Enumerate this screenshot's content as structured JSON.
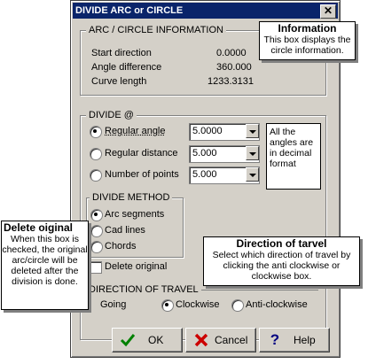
{
  "window": {
    "title": "DIVIDE ARC or CIRCLE",
    "close_glyph": "✕"
  },
  "arc_info": {
    "legend": "ARC / CIRCLE INFORMATION",
    "rows": [
      {
        "label": "Start direction",
        "value": "0.0000"
      },
      {
        "label": "Angle difference",
        "value": "360.000"
      },
      {
        "label": "Curve length",
        "value": "1233.3131"
      }
    ]
  },
  "divide": {
    "legend": "DIVIDE @",
    "options": [
      {
        "label": "Regular angle",
        "value": "5.0000",
        "selected": true
      },
      {
        "label": "Regular distance",
        "value": "5.000",
        "selected": false
      },
      {
        "label": "Number of points",
        "value": "5.000",
        "selected": false
      }
    ],
    "note": "All the angles are in decimal format"
  },
  "divide_method": {
    "legend": "DIVIDE METHOD",
    "options": [
      {
        "label": "Arc segments",
        "selected": true
      },
      {
        "label": "Cad lines",
        "selected": false
      },
      {
        "label": "Chords",
        "selected": false
      }
    ]
  },
  "delete_original": {
    "label": "Delete original",
    "checked": false
  },
  "direction": {
    "legend": "DIRECTION OF TRAVEL",
    "going_label": "Going",
    "options": [
      {
        "label": "Clockwise",
        "selected": true
      },
      {
        "label": "Anti-clockwise",
        "selected": false
      }
    ]
  },
  "buttons": {
    "ok": {
      "label": "OK",
      "icon": "checkmark-icon",
      "color": "#008000"
    },
    "cancel": {
      "label": "Cancel",
      "icon": "red-x-icon",
      "color": "#cc0000"
    },
    "help": {
      "label": "Help",
      "icon": "question-mark-icon",
      "color": "#000080"
    }
  },
  "callouts": {
    "information": {
      "title": "Information",
      "body": "This box displays the circle information."
    },
    "delete": {
      "title": "Delete oiginal",
      "body": "When this box is checked, the original arc/circle will be deleted after the division is done."
    },
    "direction": {
      "title": "Direction of tarvel",
      "body": "Select which direction of travel by clicking the anti clockwise or clockwise box."
    }
  }
}
